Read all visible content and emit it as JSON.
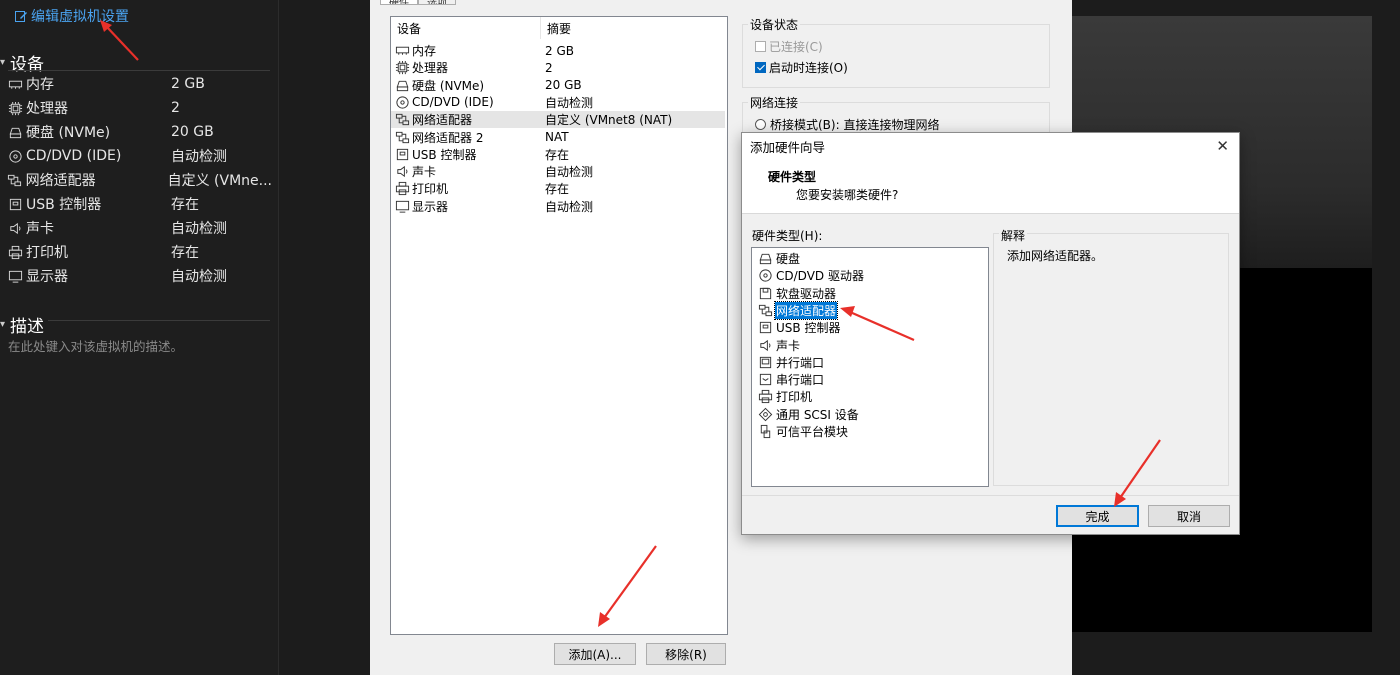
{
  "left_panel": {
    "edit_link": "编辑虚拟机设置",
    "devices_heading": "设备",
    "devices": [
      {
        "icon": "memory-icon",
        "name": "内存",
        "value": "2 GB"
      },
      {
        "icon": "cpu-icon",
        "name": "处理器",
        "value": "2"
      },
      {
        "icon": "hdd-icon",
        "name": "硬盘 (NVMe)",
        "value": "20 GB"
      },
      {
        "icon": "cdrom-icon",
        "name": "CD/DVD (IDE)",
        "value": "自动检测"
      },
      {
        "icon": "network-icon",
        "name": "网络适配器",
        "value": "自定义 (VMne..."
      },
      {
        "icon": "usb-icon",
        "name": "USB 控制器",
        "value": "存在"
      },
      {
        "icon": "speaker-icon",
        "name": "声卡",
        "value": "自动检测"
      },
      {
        "icon": "printer-icon",
        "name": "打印机",
        "value": "存在"
      },
      {
        "icon": "monitor-icon",
        "name": "显示器",
        "value": "自动检测"
      }
    ],
    "description_heading": "描述",
    "description_placeholder": "在此处键入对该虚拟机的描述。"
  },
  "settings_dialog": {
    "tabs": [
      "硬件",
      "选项"
    ],
    "columns": {
      "device": "设备",
      "summary": "摘要"
    },
    "devices": [
      {
        "icon": "memory-icon",
        "name": "内存",
        "summary": "2 GB"
      },
      {
        "icon": "cpu-icon",
        "name": "处理器",
        "summary": "2"
      },
      {
        "icon": "hdd-icon",
        "name": "硬盘 (NVMe)",
        "summary": "20 GB"
      },
      {
        "icon": "cdrom-icon",
        "name": "CD/DVD (IDE)",
        "summary": "自动检测"
      },
      {
        "icon": "network-icon",
        "name": "网络适配器",
        "summary": "自定义 (VMnet8 (NAT)"
      },
      {
        "icon": "network-icon",
        "name": "网络适配器 2",
        "summary": "NAT"
      },
      {
        "icon": "usb-icon",
        "name": "USB 控制器",
        "summary": "存在"
      },
      {
        "icon": "speaker-icon",
        "name": "声卡",
        "summary": "自动检测"
      },
      {
        "icon": "printer-icon",
        "name": "打印机",
        "summary": "存在"
      },
      {
        "icon": "monitor-icon",
        "name": "显示器",
        "summary": "自动检测"
      }
    ],
    "selected_index": 4,
    "add_button": "添加(A)...",
    "remove_button": "移除(R)",
    "device_status": {
      "label": "设备状态",
      "connected": "已连接(C)",
      "connect_on_start": "启动时连接(O)"
    },
    "network": {
      "label": "网络连接",
      "bridged": "桥接模式(B): 直接连接物理网络"
    }
  },
  "wizard": {
    "title": "添加硬件向导",
    "close_glyph": "✕",
    "heading": "硬件类型",
    "subheading": "您要安装哪类硬件?",
    "hw_label": "硬件类型(H):",
    "hw_types": [
      {
        "icon": "hdd-icon",
        "name": "硬盘"
      },
      {
        "icon": "cdrom-icon",
        "name": "CD/DVD 驱动器"
      },
      {
        "icon": "floppy-icon",
        "name": "软盘驱动器"
      },
      {
        "icon": "network-icon",
        "name": "网络适配器"
      },
      {
        "icon": "usb-icon",
        "name": "USB 控制器"
      },
      {
        "icon": "speaker-icon",
        "name": "声卡"
      },
      {
        "icon": "parallel-port-icon",
        "name": "并行端口"
      },
      {
        "icon": "serial-port-icon",
        "name": "串行端口"
      },
      {
        "icon": "printer-icon",
        "name": "打印机"
      },
      {
        "icon": "scsi-icon",
        "name": "通用 SCSI 设备"
      },
      {
        "icon": "tpm-icon",
        "name": "可信平台模块"
      }
    ],
    "selected_index": 3,
    "explanation_label": "解释",
    "explanation_text": "添加网络适配器。",
    "finish_button": "完成",
    "cancel_button": "取消"
  },
  "colors": {
    "accent": "#0078d7",
    "annotation_arrow": "#e8302a",
    "link": "#4aa3f0"
  }
}
